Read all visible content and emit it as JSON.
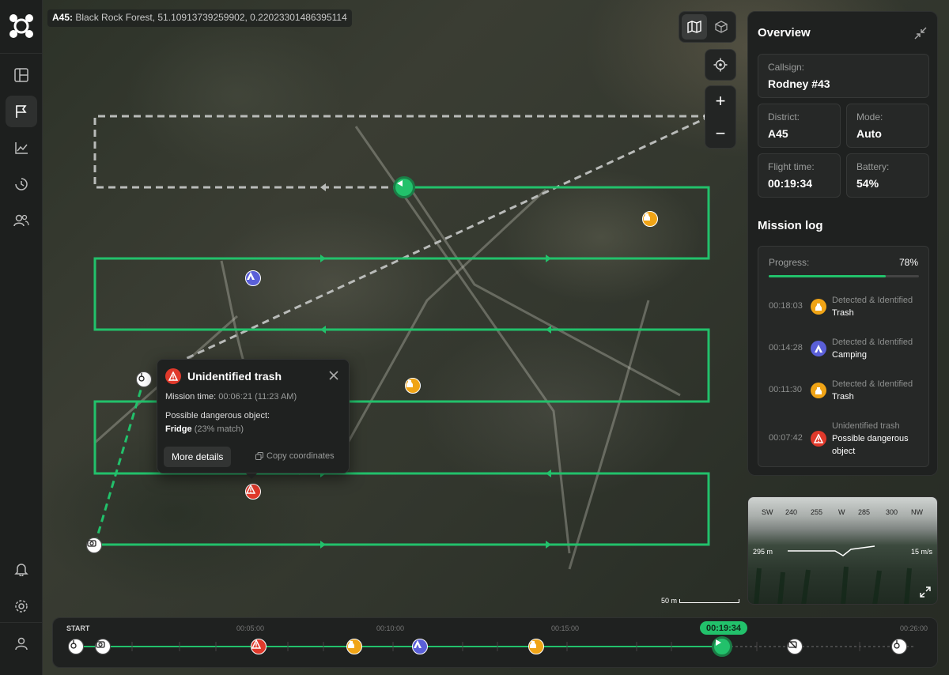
{
  "location": {
    "district": "A45:",
    "coordinates": "Black Rock Forest, 51.10913739259902, 0.22023301486395114"
  },
  "sidebar": {
    "items": [
      {
        "name": "dashboard",
        "active": false
      },
      {
        "name": "missions",
        "active": true
      },
      {
        "name": "analytics",
        "active": false
      },
      {
        "name": "history",
        "active": false
      },
      {
        "name": "team",
        "active": false
      }
    ],
    "bottom": [
      "notifications",
      "settings",
      "profile"
    ]
  },
  "map_controls": {
    "view_modes": [
      "map-view",
      "3d-view"
    ],
    "active_view": "map-view",
    "zoom_in": "+",
    "zoom_out": "−"
  },
  "overview": {
    "title": "Overview",
    "callsign_label": "Callsign:",
    "callsign": "Rodney #43",
    "district_label": "District:",
    "district": "A45",
    "mode_label": "Mode:",
    "mode": "Auto",
    "flight_time_label": "Flight time:",
    "flight_time": "00:19:34",
    "battery_label": "Battery:",
    "battery": "54%"
  },
  "mission_log": {
    "title": "Mission log",
    "progress_label": "Progress:",
    "progress_value": "78%",
    "progress_fraction": 0.78,
    "entries": [
      {
        "time": "00:18:03",
        "line1": "Detected & Identified",
        "line2": "Trash",
        "icon": "trash-icon",
        "color": "#f0a416"
      },
      {
        "time": "00:14:28",
        "line1": "Detected & Identified",
        "line2": "Camping",
        "icon": "tent-icon",
        "color": "#5a5fd8"
      },
      {
        "time": "00:11:30",
        "line1": "Detected & Identified",
        "line2": "Trash",
        "icon": "trash-icon",
        "color": "#f0a416"
      },
      {
        "time": "00:07:42",
        "line1": "Unidentified trash",
        "line2": "Possible dangerous object",
        "icon": "warning-icon",
        "color": "#e0392b"
      }
    ]
  },
  "camera": {
    "headings": [
      "SW",
      "240",
      "255",
      "W",
      "285",
      "300",
      "NW"
    ],
    "altitude": "295 m",
    "speed": "15 m/s"
  },
  "scale": {
    "label": "50 m"
  },
  "popup": {
    "title": "Unidentified trash",
    "mission_time_label": "Mission time:",
    "mission_time": "00:06:21 (11:23 AM)",
    "description": "Possible dangerous object:",
    "object": "Fridge",
    "match": "(23% match)",
    "more_details": "More details",
    "copy_coordinates": "Copy coordinates"
  },
  "timeline": {
    "start_label": "START",
    "ticks": [
      "00:05:00",
      "00:10:00",
      "00:15:00",
      "00:26:00"
    ],
    "current_time": "00:19:34",
    "events": [
      {
        "type": "takeoff",
        "icon": "takeoff-icon"
      },
      {
        "type": "camera",
        "icon": "camera-icon"
      },
      {
        "type": "warning",
        "icon": "warning-icon"
      },
      {
        "type": "trash",
        "icon": "trash-icon"
      },
      {
        "type": "camping",
        "icon": "tent-icon"
      },
      {
        "type": "trash",
        "icon": "trash-icon"
      },
      {
        "type": "current",
        "icon": "play-icon"
      },
      {
        "type": "camera-off",
        "icon": "camera-off-icon"
      },
      {
        "type": "landing",
        "icon": "landing-icon"
      }
    ]
  },
  "colors": {
    "accent": "#22c16b",
    "warning": "#e0392b",
    "trash": "#f0a416",
    "camping": "#5a5fd8"
  }
}
